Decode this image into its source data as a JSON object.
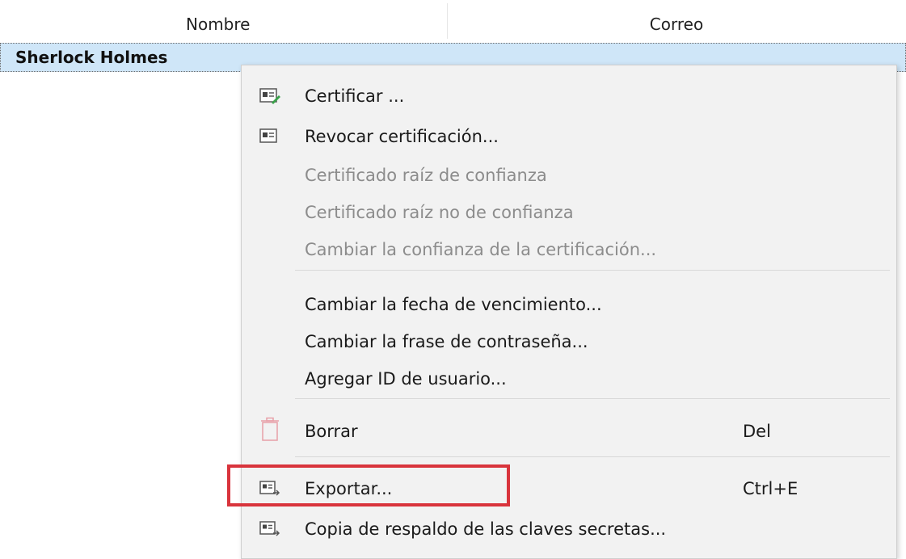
{
  "table": {
    "headers": {
      "name": "Nombre",
      "email": "Correo"
    },
    "selected_row": {
      "name": "Sherlock Holmes"
    }
  },
  "context_menu": {
    "items": [
      {
        "label": "Certificar ...",
        "icon": "certificate-edit-icon",
        "enabled": true
      },
      {
        "label": "Revocar certificación...",
        "icon": "certificate-card-icon",
        "enabled": true
      },
      {
        "label": "Certificado raíz de confianza",
        "enabled": false
      },
      {
        "label": "Certificado raíz no de confianza",
        "enabled": false
      },
      {
        "label": "Cambiar la confianza de la certificación...",
        "enabled": false
      },
      {
        "label": "Cambiar la fecha de vencimiento...",
        "enabled": true
      },
      {
        "label": "Cambiar la frase de contraseña...",
        "enabled": true
      },
      {
        "label": "Agregar ID de usuario...",
        "enabled": true
      },
      {
        "label": "Borrar",
        "icon": "trash-icon",
        "shortcut": "Del",
        "enabled": true
      },
      {
        "label": "Exportar...",
        "icon": "export-icon",
        "shortcut": "Ctrl+E",
        "enabled": true,
        "highlighted": true
      },
      {
        "label": "Copia de respaldo de las claves secretas...",
        "icon": "export-icon",
        "enabled": true
      }
    ]
  },
  "colors": {
    "selection": "#cfe6f8",
    "highlight_box": "#d9343c",
    "disabled_text": "#8c8c8c",
    "menu_background": "#f2f2f2",
    "trash_icon": "#e8a0a8",
    "edit_pen": "#3aa24a"
  }
}
